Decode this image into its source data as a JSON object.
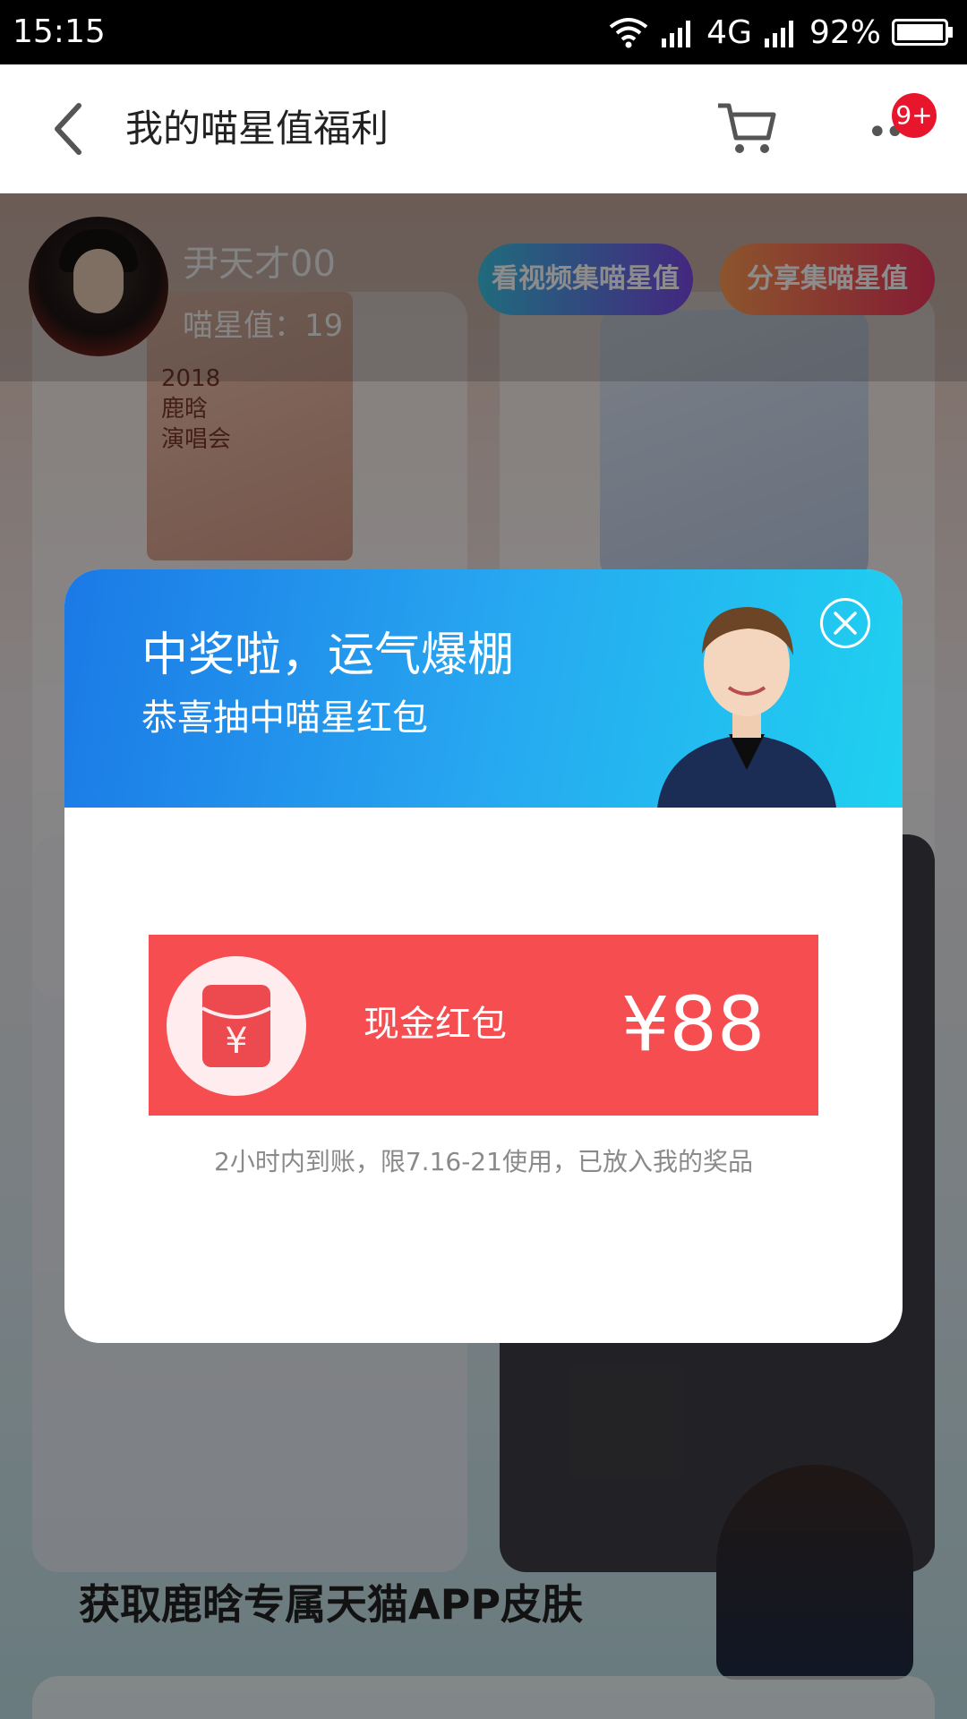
{
  "status_bar": {
    "time": "15:15",
    "network": "4G",
    "battery": "92%"
  },
  "header": {
    "title": "我的喵星值福利",
    "badge": "9+"
  },
  "profile": {
    "username": "尹天才00",
    "star_value": "喵星值：19"
  },
  "actions": {
    "watch_video": "看视频集喵星值",
    "share": "分享集喵星值"
  },
  "products": {
    "ticket_text": "2018\n鹿晗\n演唱会"
  },
  "sections": {
    "skin_title": "获取鹿晗专属天猫APP皮肤"
  },
  "modal": {
    "title": "中奖啦，运气爆棚",
    "subtitle": "恭喜抽中喵星红包",
    "prize_label": "现金红包",
    "prize_amount": "¥88",
    "note": "2小时内到账，限7.16-21使用，已放入我的奖品"
  },
  "colors": {
    "accent_red": "#f64d51",
    "badge_red": "#e8162c",
    "banner_blue": "#27a6f0"
  }
}
